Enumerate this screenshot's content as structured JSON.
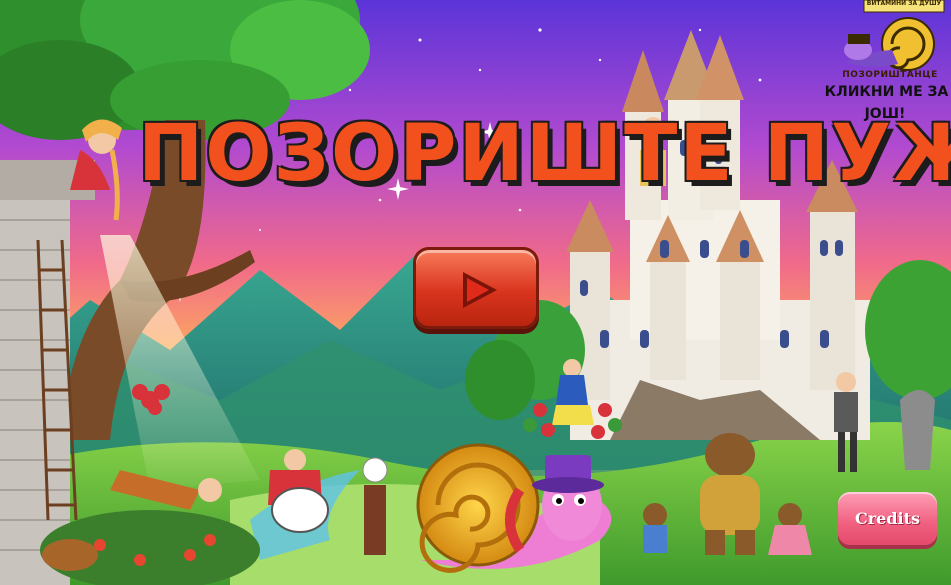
{
  "game": {
    "title": "ПОЗОРИШТЕ ПУЖ",
    "play_button_icon": "play-icon",
    "credits_label": "Credits"
  },
  "promo": {
    "flag_text": "ВИТАМИНИ ЗА ДУШУ",
    "brand": "ПОЗОРИШТАНЦЕ",
    "line1": "КЛИКНИ МЕ ЗА",
    "line2": "ЈОШ!"
  },
  "colors": {
    "title": "#f2511e",
    "play_button": "#e0391f",
    "credits_button": "#f0607f",
    "sky_top": "#6a3bd6",
    "sky_bottom": "#ffb347",
    "grass": "#6fc23a"
  }
}
